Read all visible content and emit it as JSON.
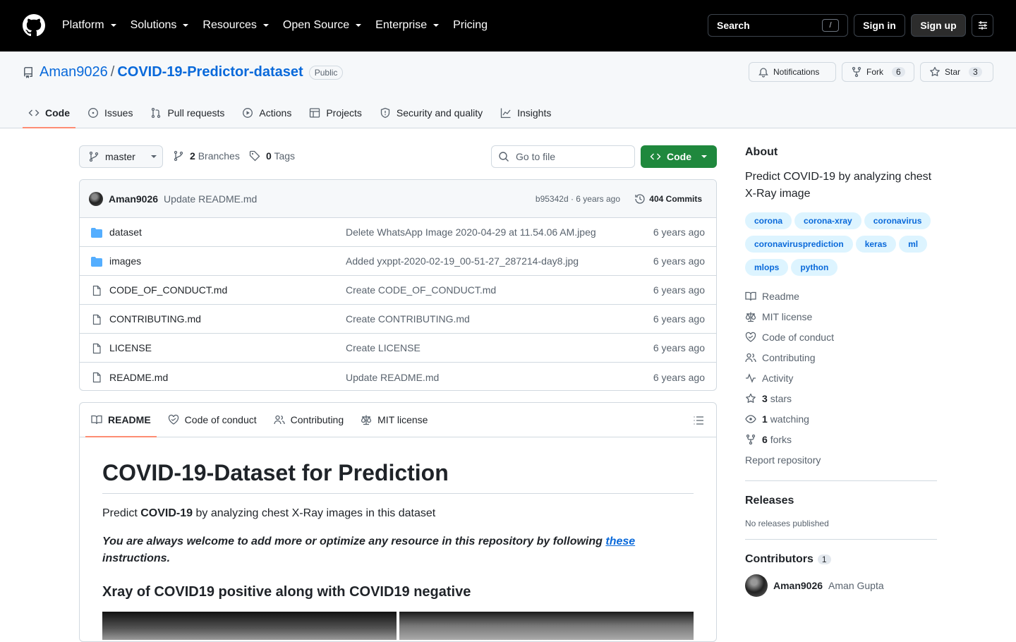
{
  "header": {
    "nav": [
      "Platform",
      "Solutions",
      "Resources",
      "Open Source",
      "Enterprise",
      "Pricing"
    ],
    "search_label": "Search",
    "search_kbd": "/",
    "signin": "Sign in",
    "signup": "Sign up"
  },
  "repo": {
    "owner": "Aman9026",
    "separator": "/",
    "name": "COVID-19-Predictor-dataset",
    "visibility": "Public",
    "notifications": "Notifications",
    "fork_label": "Fork",
    "fork_count": "6",
    "star_label": "Star",
    "star_count": "3",
    "tabs": [
      "Code",
      "Issues",
      "Pull requests",
      "Actions",
      "Projects",
      "Security and quality",
      "Insights"
    ]
  },
  "toolbar": {
    "branch": "master",
    "branches_count": "2",
    "branches_label": "Branches",
    "tags_count": "0",
    "tags_label": "Tags",
    "go_to_file": "Go to file",
    "code_button": "Code"
  },
  "commit": {
    "author": "Aman9026",
    "message": "Update README.md",
    "meta": "b95342d · 6 years ago",
    "commits": "404 Commits"
  },
  "files": [
    {
      "type": "folder",
      "name": "dataset",
      "message": "Delete WhatsApp Image 2020-04-29 at 11.54.06 AM.jpeg",
      "date": "6 years ago"
    },
    {
      "type": "folder",
      "name": "images",
      "message": "Added yxppt-2020-02-19_00-51-27_287214-day8.jpg",
      "date": "6 years ago"
    },
    {
      "type": "file",
      "name": "CODE_OF_CONDUCT.md",
      "message": "Create CODE_OF_CONDUCT.md",
      "date": "6 years ago"
    },
    {
      "type": "file",
      "name": "CONTRIBUTING.md",
      "message": "Create CONTRIBUTING.md",
      "date": "6 years ago"
    },
    {
      "type": "file",
      "name": "LICENSE",
      "message": "Create LICENSE",
      "date": "6 years ago"
    },
    {
      "type": "file",
      "name": "README.md",
      "message": "Update README.md",
      "date": "6 years ago"
    }
  ],
  "readme": {
    "tabs": [
      "README",
      "Code of conduct",
      "Contributing",
      "MIT license"
    ],
    "h1": "COVID-19-Dataset for Prediction",
    "p1_pre": "Predict ",
    "p1_bold": "COVID-19",
    "p1_post": " by analyzing chest X-Ray images in this dataset",
    "p2_text": "You are always welcome to add more or optimize any resource in this repository by following ",
    "p2_link": "these",
    "p2_end": " instructions.",
    "h2": "Xray of COVID19 positive along with COVID19 negative"
  },
  "about": {
    "title": "About",
    "description": "Predict COVID-19 by analyzing chest X-Ray image",
    "topics": [
      "corona",
      "corona-xray",
      "coronavirus",
      "coronavirusprediction",
      "keras",
      "ml",
      "mlops",
      "python"
    ],
    "links": [
      "Readme",
      "MIT license",
      "Code of conduct",
      "Contributing",
      "Activity"
    ],
    "stars_count": "3",
    "stars_label": "stars",
    "watching_count": "1",
    "watching_label": "watching",
    "forks_count": "6",
    "forks_label": "forks",
    "report": "Report repository"
  },
  "releases": {
    "title": "Releases",
    "none": "No releases published"
  },
  "contributors": {
    "title": "Contributors",
    "count": "1",
    "login": "Aman9026",
    "fullname": "Aman Gupta"
  }
}
